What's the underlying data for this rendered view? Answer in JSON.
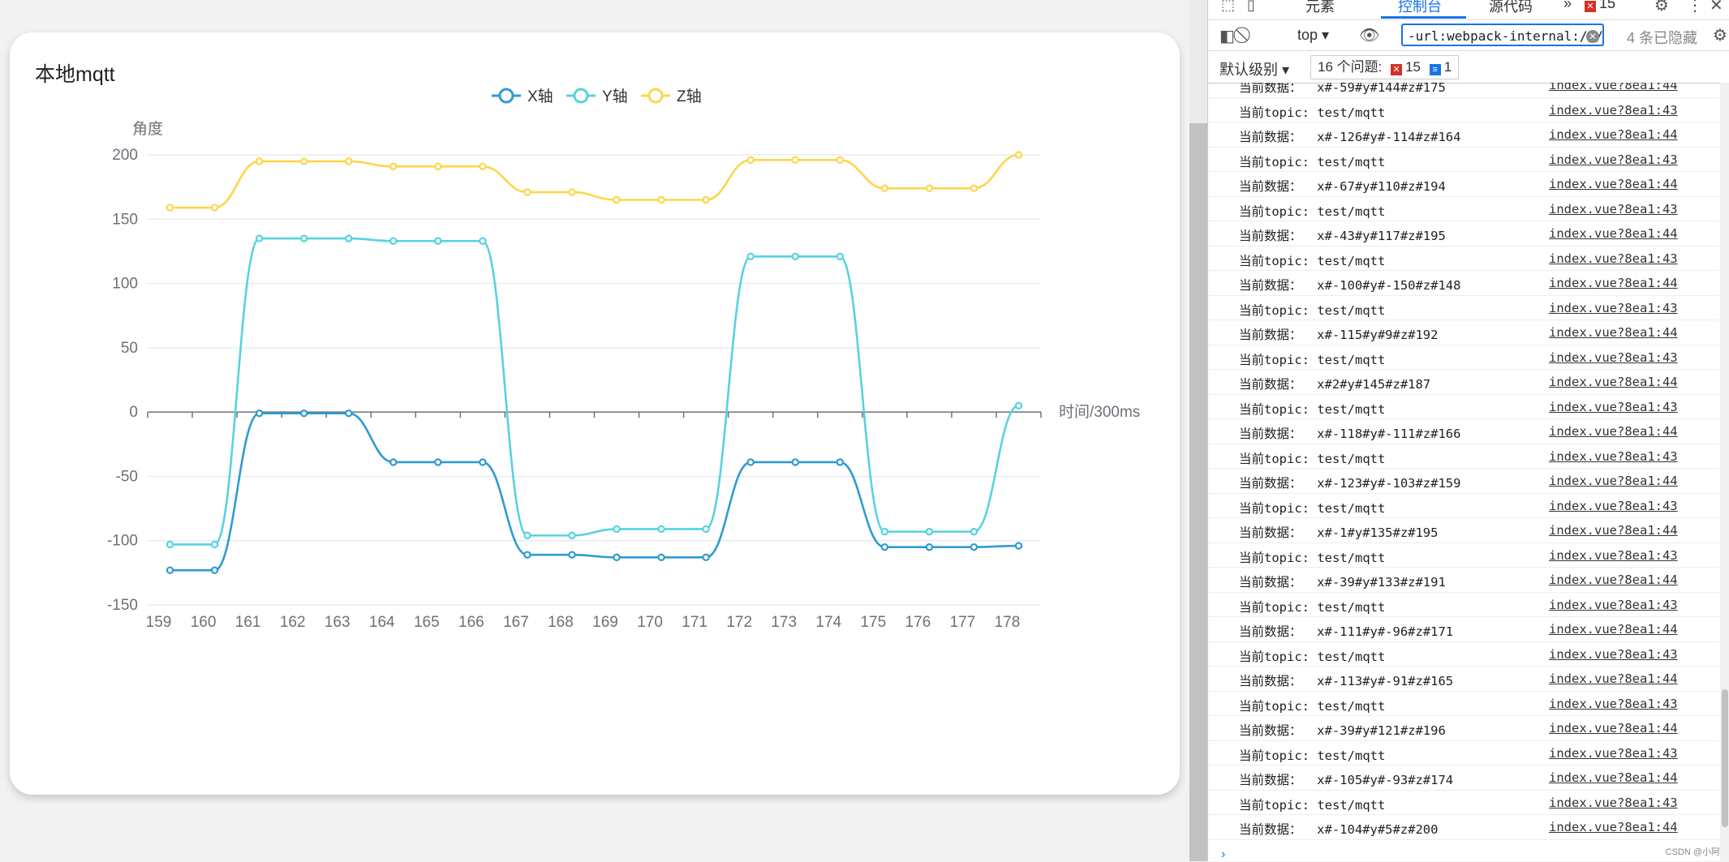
{
  "card": {
    "title": "本地mqtt"
  },
  "chart_data": {
    "type": "line",
    "smooth": true,
    "categories": [
      "159",
      "160",
      "161",
      "162",
      "163",
      "164",
      "165",
      "166",
      "167",
      "168",
      "169",
      "170",
      "171",
      "172",
      "173",
      "174",
      "175",
      "176",
      "177",
      "178"
    ],
    "series": [
      {
        "name": "X轴",
        "color": "#2f9bd0",
        "values": [
          -123,
          -123,
          -1,
          -1,
          -1,
          -39,
          -39,
          -39,
          -111,
          -111,
          -113,
          -113,
          -113,
          -39,
          -39,
          -39,
          -105,
          -105,
          -105,
          -104
        ]
      },
      {
        "name": "Y轴",
        "color": "#56d3e0",
        "values": [
          -103,
          -103,
          135,
          135,
          135,
          133,
          133,
          133,
          -96,
          -96,
          -91,
          -91,
          -91,
          121,
          121,
          121,
          -93,
          -93,
          -93,
          5
        ]
      },
      {
        "name": "Z轴",
        "color": "#fdd64b",
        "values": [
          159,
          159,
          195,
          195,
          195,
          191,
          191,
          191,
          171,
          171,
          165,
          165,
          165,
          196,
          196,
          196,
          174,
          174,
          174,
          200
        ]
      }
    ],
    "ylabel": "角度",
    "xlabel": "时间/300ms",
    "ylim": [
      -150,
      200
    ],
    "yticks": [
      200,
      150,
      100,
      50,
      0,
      -50,
      -100,
      -150
    ],
    "grid": true,
    "legend": "top-center"
  },
  "devtools": {
    "tabs": [
      "元素",
      "控制台",
      "源代码"
    ],
    "more": "»",
    "error_count": "15",
    "context": "top",
    "filter_value": "-url:webpack-internal:///./no",
    "hidden_count": "4 条已隐藏",
    "level": "默认级别",
    "issues_label": "16 个问题:",
    "issues_errors": "15",
    "issues_info": "1",
    "rows": [
      {
        "msg": "当前数据：  x#-59#y#144#z#175",
        "src": "index.vue?8ea1:44"
      },
      {
        "msg": "当前topic: test/mqtt",
        "src": "index.vue?8ea1:43"
      },
      {
        "msg": "当前数据：  x#-126#y#-114#z#164",
        "src": "index.vue?8ea1:44"
      },
      {
        "msg": "当前topic: test/mqtt",
        "src": "index.vue?8ea1:43"
      },
      {
        "msg": "当前数据：  x#-67#y#110#z#194",
        "src": "index.vue?8ea1:44"
      },
      {
        "msg": "当前topic: test/mqtt",
        "src": "index.vue?8ea1:43"
      },
      {
        "msg": "当前数据：  x#-43#y#117#z#195",
        "src": "index.vue?8ea1:44"
      },
      {
        "msg": "当前topic: test/mqtt",
        "src": "index.vue?8ea1:43"
      },
      {
        "msg": "当前数据：  x#-100#y#-150#z#148",
        "src": "index.vue?8ea1:44"
      },
      {
        "msg": "当前topic: test/mqtt",
        "src": "index.vue?8ea1:43"
      },
      {
        "msg": "当前数据：  x#-115#y#9#z#192",
        "src": "index.vue?8ea1:44"
      },
      {
        "msg": "当前topic: test/mqtt",
        "src": "index.vue?8ea1:43"
      },
      {
        "msg": "当前数据：  x#2#y#145#z#187",
        "src": "index.vue?8ea1:44"
      },
      {
        "msg": "当前topic: test/mqtt",
        "src": "index.vue?8ea1:43"
      },
      {
        "msg": "当前数据：  x#-118#y#-111#z#166",
        "src": "index.vue?8ea1:44"
      },
      {
        "msg": "当前topic: test/mqtt",
        "src": "index.vue?8ea1:43"
      },
      {
        "msg": "当前数据：  x#-123#y#-103#z#159",
        "src": "index.vue?8ea1:44"
      },
      {
        "msg": "当前topic: test/mqtt",
        "src": "index.vue?8ea1:43"
      },
      {
        "msg": "当前数据：  x#-1#y#135#z#195",
        "src": "index.vue?8ea1:44"
      },
      {
        "msg": "当前topic: test/mqtt",
        "src": "index.vue?8ea1:43"
      },
      {
        "msg": "当前数据：  x#-39#y#133#z#191",
        "src": "index.vue?8ea1:44"
      },
      {
        "msg": "当前topic: test/mqtt",
        "src": "index.vue?8ea1:43"
      },
      {
        "msg": "当前数据：  x#-111#y#-96#z#171",
        "src": "index.vue?8ea1:44"
      },
      {
        "msg": "当前topic: test/mqtt",
        "src": "index.vue?8ea1:43"
      },
      {
        "msg": "当前数据：  x#-113#y#-91#z#165",
        "src": "index.vue?8ea1:44"
      },
      {
        "msg": "当前topic: test/mqtt",
        "src": "index.vue?8ea1:43"
      },
      {
        "msg": "当前数据：  x#-39#y#121#z#196",
        "src": "index.vue?8ea1:44"
      },
      {
        "msg": "当前topic: test/mqtt",
        "src": "index.vue?8ea1:43"
      },
      {
        "msg": "当前数据：  x#-105#y#-93#z#174",
        "src": "index.vue?8ea1:44"
      },
      {
        "msg": "当前topic: test/mqtt",
        "src": "index.vue?8ea1:43"
      },
      {
        "msg": "当前数据：  x#-104#y#5#z#200",
        "src": "index.vue?8ea1:44"
      }
    ],
    "prompt": "›",
    "watermark": "CSDN @小阿"
  }
}
